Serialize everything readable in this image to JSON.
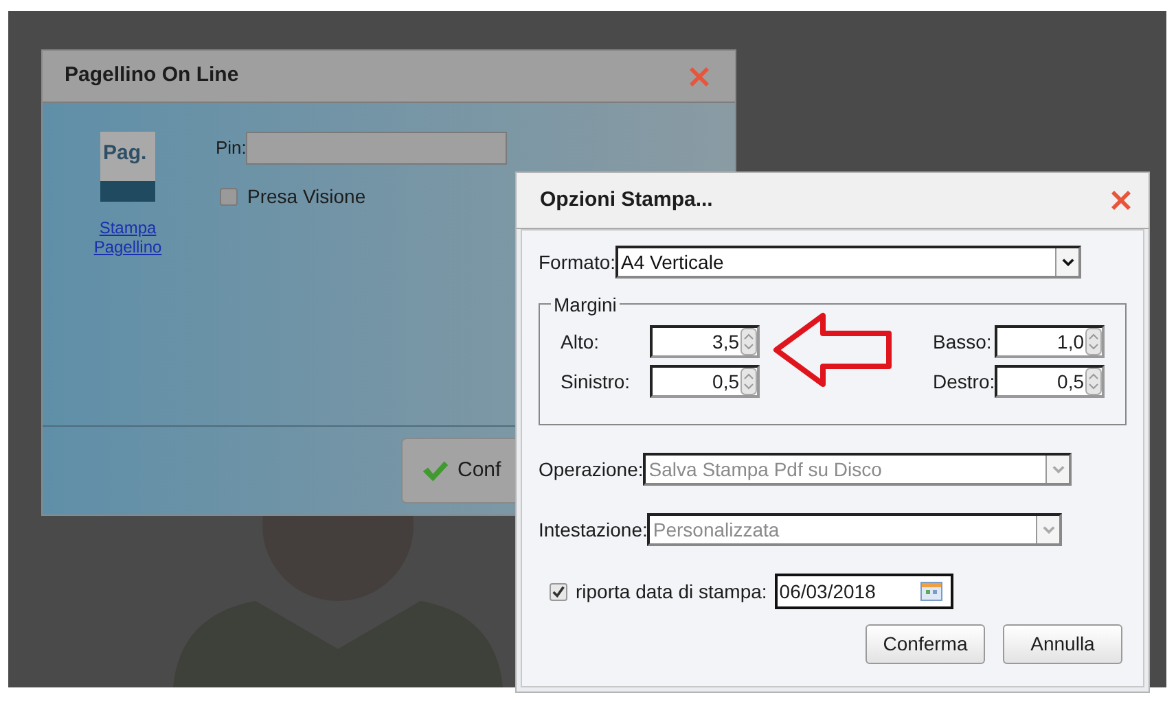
{
  "main_window": {
    "title": "Pagellino On Line",
    "icon_label": "Pag.",
    "link": "Stampa Pagellino",
    "pin": {
      "label": "Pin:"
    },
    "checkbox": {
      "label": "Presa Visione",
      "checked": false
    },
    "button": "Conf"
  },
  "dialog": {
    "title": "Opzioni Stampa...",
    "formato": {
      "label": "Formato:",
      "value": "A4 Verticale",
      "disabled": false
    },
    "margini": {
      "legend": "Margini",
      "fields": [
        {
          "label": "Alto:",
          "value": "3,5"
        },
        {
          "label": "Basso:",
          "value": "1,0"
        },
        {
          "label": "Sinistro:",
          "value": "0,5"
        },
        {
          "label": "Destro:",
          "value": "0,5"
        }
      ]
    },
    "operazione": {
      "label": "Operazione:",
      "value": "Salva Stampa Pdf su Disco",
      "disabled": true
    },
    "intestazione": {
      "label": "Intestazione:",
      "value": "Personalizzata",
      "disabled": true
    },
    "date_option": {
      "label": "riporta data di stampa:",
      "checked": true,
      "value": "06/03/2018"
    },
    "buttons": [
      "Conferma",
      "Annulla"
    ]
  }
}
